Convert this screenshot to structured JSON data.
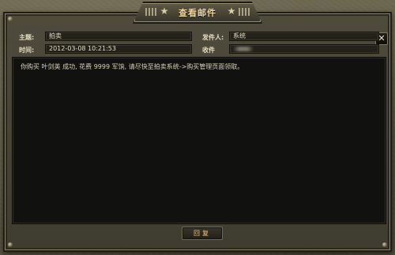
{
  "window": {
    "title": "查看邮件",
    "close_symbol": "✕"
  },
  "header": {
    "subject_label": "主题:",
    "subject_value": "拍卖",
    "time_label": "时间:",
    "time_value": "2012-03-08 10:21:53",
    "sender_label": "发件人:",
    "sender_value": "系统",
    "recipient_label": "收件"
  },
  "message": {
    "body": "你购买 叶剑英 成功, 花费 9999 军饷, 请尽快至拍卖系统->购买管理页面领取。"
  },
  "actions": {
    "reply_label": "回复"
  },
  "icons": {
    "title_decoration": "star-icon",
    "close": "close-icon"
  }
}
